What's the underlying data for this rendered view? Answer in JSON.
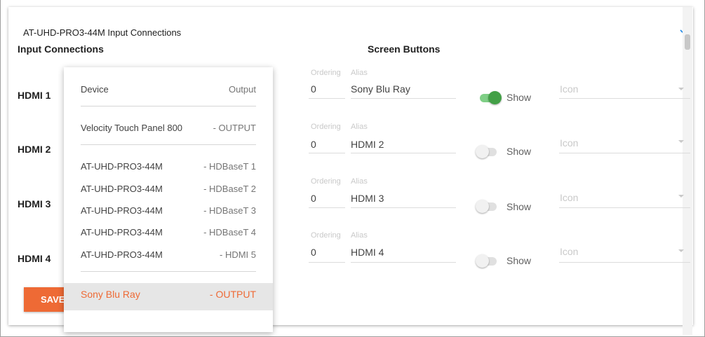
{
  "card": {
    "title": "AT-UHD-PRO3-44M Input Connections"
  },
  "sections": {
    "input_connections": "Input Connections",
    "screen_buttons": "Screen Buttons"
  },
  "inputs": [
    {
      "label": "HDMI 1",
      "ordering": "0",
      "alias": "Sony Blu Ray",
      "show_on": true
    },
    {
      "label": "HDMI 2",
      "ordering": "0",
      "alias": "HDMI 2",
      "show_on": false
    },
    {
      "label": "HDMI 3",
      "ordering": "0",
      "alias": "HDMI 3",
      "show_on": false
    },
    {
      "label": "HDMI 4",
      "ordering": "0",
      "alias": "HDMI 4",
      "show_on": false
    }
  ],
  "fields": {
    "ordering_label": "Ordering",
    "alias_label": "Alias",
    "show_label": "Show",
    "icon_placeholder": "Icon"
  },
  "save_button": "SAVE",
  "dropdown": {
    "header": {
      "left": "Device",
      "right": "Output"
    },
    "items": [
      {
        "device": "Velocity Touch Panel 800",
        "output": "- OUTPUT"
      },
      {
        "device": "AT-UHD-PRO3-44M",
        "output": "- HDBaseT 1"
      },
      {
        "device": "AT-UHD-PRO3-44M",
        "output": "- HDBaseT 2"
      },
      {
        "device": "AT-UHD-PRO3-44M",
        "output": "- HDBaseT 3"
      },
      {
        "device": "AT-UHD-PRO3-44M",
        "output": "- HDBaseT 4"
      },
      {
        "device": "AT-UHD-PRO3-44M",
        "output": "- HDMI 5"
      },
      {
        "device": "Sony Blu Ray",
        "output": "- OUTPUT",
        "selected": true
      }
    ]
  },
  "colors": {
    "accent": "#ee6a35",
    "toggle_on": "#43a047"
  },
  "icons": {
    "collapse": "chevron-down-icon",
    "select": "caret-down-icon"
  }
}
